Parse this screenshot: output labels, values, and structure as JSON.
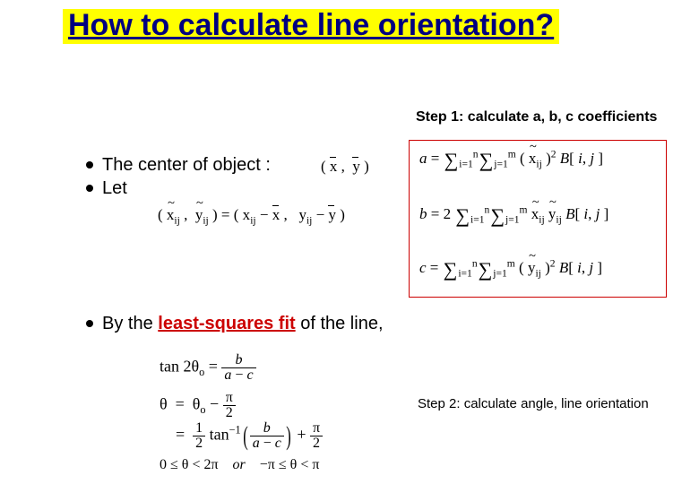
{
  "title": "How to calculate line orientation?",
  "step1_label": "Step 1: calculate a, b, c coefficients",
  "bullets": {
    "center": "The center of object :",
    "let": "Let",
    "by_pre": "By the ",
    "by_red": "least-squares fit",
    "by_post": " of the line,"
  },
  "math": {
    "xy_tuple": "( x̄ ,  ȳ )",
    "let_line": "( x̃ᵢⱼ ,  ỹᵢⱼ ) = ( xᵢⱼ − x̄ ,  yᵢⱼ − ȳ )",
    "a": "a = ΣᵢΣⱼ ( x̃ᵢⱼ )² B[ i, j ]",
    "b": "b = 2 ΣᵢΣⱼ x̃ᵢⱼ ỹᵢⱼ B[ i, j ]",
    "c": "c = ΣᵢΣⱼ ( ỹᵢⱼ )² B[ i, j ]",
    "tan": "tan 2θ₀ = b / (a − c)",
    "theta1": "θ  =  θ₀ − π/2",
    "theta2": "=  ½ tan⁻¹( b / (a − c) ) + π/2",
    "range": "0 ≤ θ < 2π   or   −π ≤ θ < π"
  },
  "step2_label": "Step 2: calculate angle, line orientation"
}
